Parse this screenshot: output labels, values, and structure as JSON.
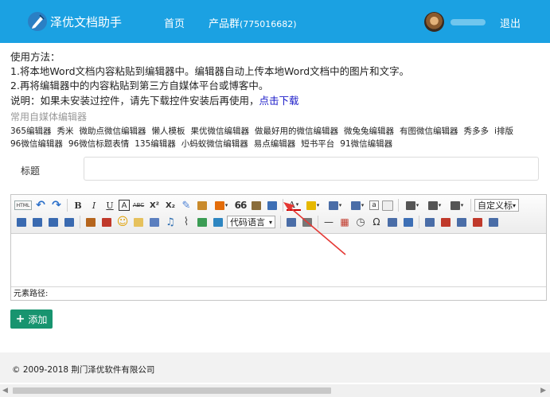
{
  "header": {
    "app_title": "泽优文档助手",
    "nav": {
      "home": "首页",
      "group": "产品群",
      "group_number": "(775016682)",
      "logout": "退出"
    }
  },
  "instructions": {
    "heading": "使用方法：",
    "step1": "1.将本地Word文档内容粘贴到编辑器中。编辑器自动上传本地Word文档中的图片和文字。",
    "step2": "2.再将编辑器中的内容粘贴到第三方自媒体平台或博客中。",
    "note": "说明：如果未安装过控件，请先下载控件安装后再使用，",
    "download_link": "点击下载"
  },
  "common_editors": {
    "title": "常用自媒体编辑器",
    "items": [
      "365编辑器",
      "秀米",
      "微助点微信编辑器",
      "懒人模板",
      "果优微信编辑器",
      "做最好用的微信编辑器",
      "微兔兔编辑器",
      "有图微信编辑器",
      "秀多多",
      "i排版",
      "96微信编辑器",
      "96微信标题表情",
      "135编辑器",
      "小蚂蚁微信编辑器",
      "易点编辑器",
      "短书平台",
      "91微信编辑器"
    ]
  },
  "form": {
    "title_label": "标题",
    "title_value": ""
  },
  "editor": {
    "toolbar_row1": [
      "html-icon",
      "undo-icon",
      "redo-icon",
      "sep",
      "bold-icon",
      "italic-icon",
      "underline-icon",
      "font-border-icon",
      "strikethrough-icon",
      "superscript-icon",
      "subscript-icon",
      "eraser-icon",
      "format-brush-icon",
      "auto-typeset-icon",
      "blockquote-icon",
      "paste-plain-icon",
      "word-image-upload-icon",
      "sep",
      "font-color-icon",
      "highlight-color-icon",
      "ordered-list-icon",
      "unordered-list-icon",
      "select-all-icon",
      "clear-doc-icon",
      "sep",
      "row-spacing-top-icon",
      "row-spacing-bottom-icon",
      "line-height-icon",
      "sep",
      "custom-title-select"
    ],
    "toolbar_row2": [
      "align-left-icon",
      "align-center-icon",
      "align-right-icon",
      "align-justify-icon",
      "sep",
      "image-icon",
      "multi-image-icon",
      "emoji-icon",
      "scrawl-icon",
      "insert-frame-icon",
      "music-icon",
      "attachment-icon",
      "map-icon",
      "gmap-icon",
      "code-language-select",
      "sep",
      "web-image-icon",
      "page-break-icon",
      "sep",
      "horizontal-rule-icon",
      "date-icon",
      "time-icon",
      "special-char-icon",
      "search-replace-icon",
      "word-image-icon",
      "sep",
      "insert-table-icon",
      "delete-table-icon",
      "insert-row-icon",
      "delete-row-icon",
      "insert-col-icon"
    ],
    "labels": {
      "bold": "B",
      "italic": "I",
      "underline": "U",
      "font_border": "A",
      "strikethrough": "ABC",
      "superscript": "X²",
      "subscript": "X₂",
      "blockquote": "66",
      "font_color": "A",
      "code_language": "代码语言",
      "custom_title": "自定义标题",
      "html": "HTML",
      "special_char": "Ω",
      "music": "♫",
      "attachment": "🔗"
    },
    "status_label": "元素路径:"
  },
  "actions": {
    "add_label": "添加"
  },
  "footer": {
    "copyright": "© 2009-2018 荆门泽优软件有限公司"
  },
  "colors": {
    "navbar": "#1ba1e2",
    "add_button": "#18946f",
    "download_link": "#1a1ac8",
    "annotation_arrow": "#e53935"
  }
}
